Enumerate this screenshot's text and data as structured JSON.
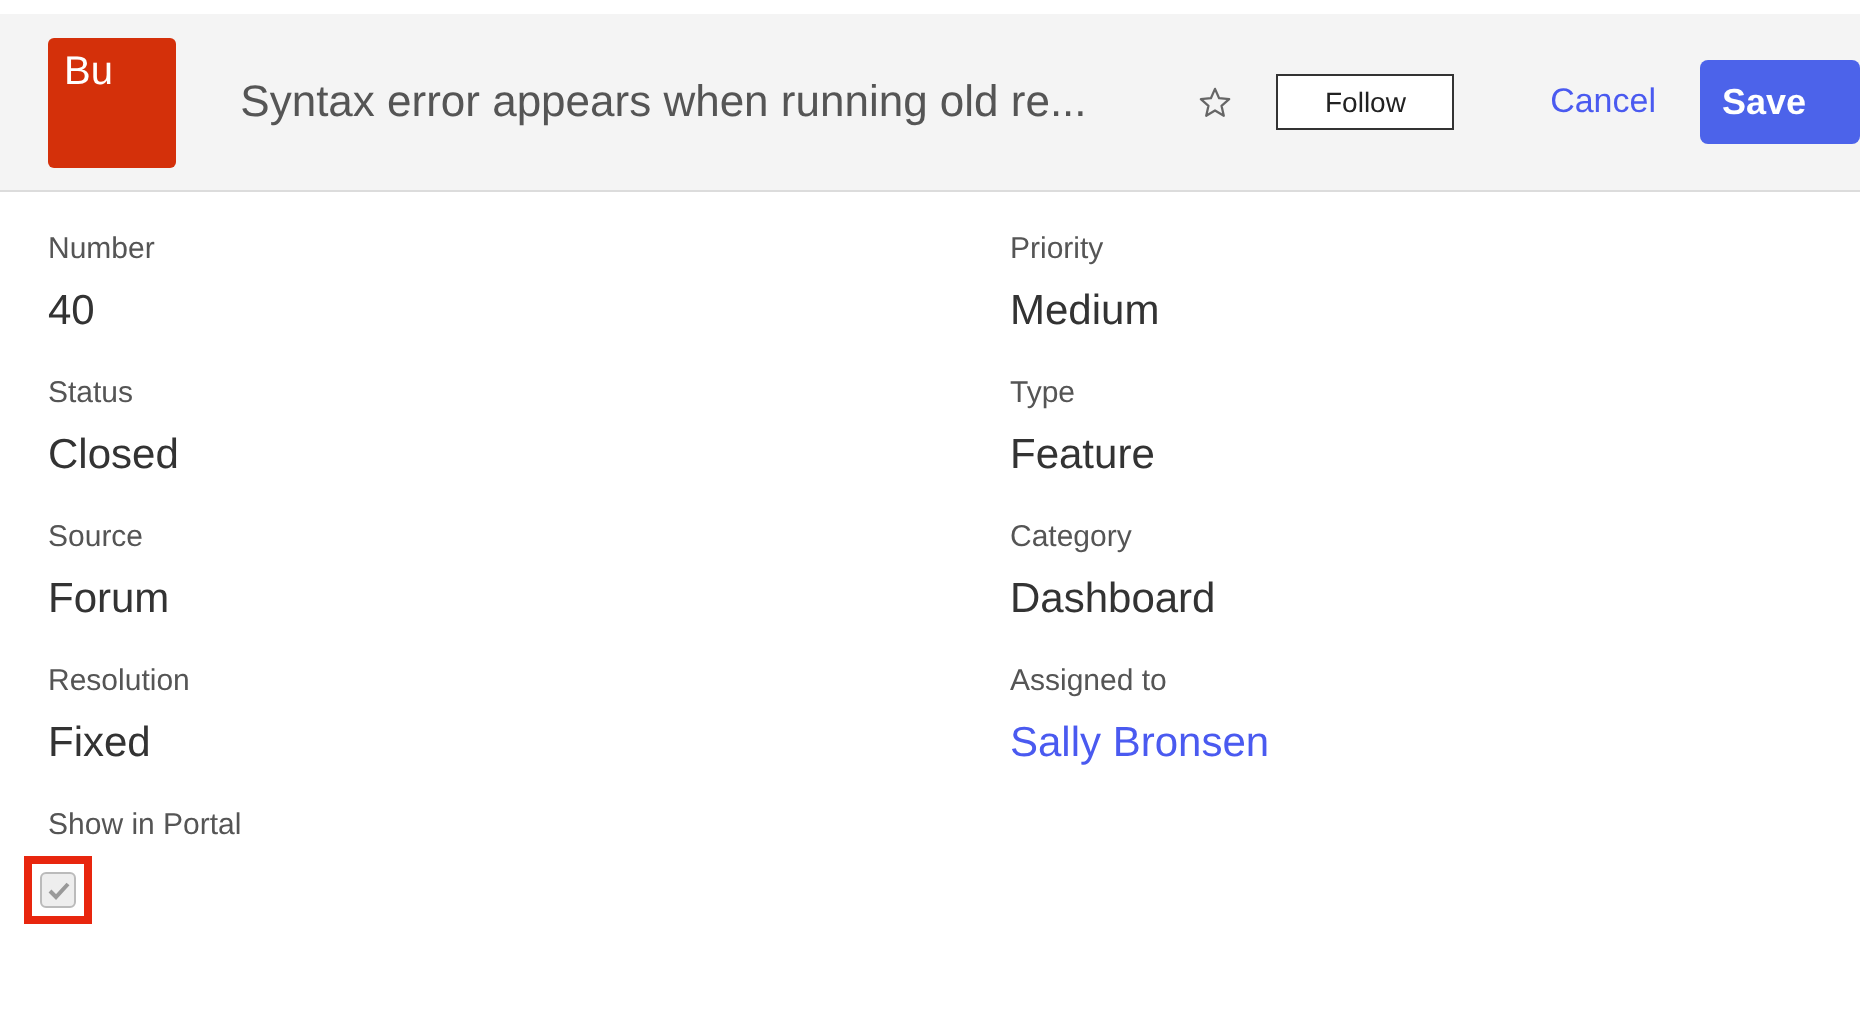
{
  "header": {
    "badge": "Bu",
    "title": "Syntax error appears when running old re...",
    "starred": false,
    "follow_label": "Follow",
    "cancel_label": "Cancel",
    "save_label": "Save"
  },
  "fields": [
    {
      "label": "Number",
      "value": "40",
      "kind": "text"
    },
    {
      "label": "Priority",
      "value": "Medium",
      "kind": "text"
    },
    {
      "label": "Status",
      "value": "Closed",
      "kind": "text"
    },
    {
      "label": "Type",
      "value": "Feature",
      "kind": "text"
    },
    {
      "label": "Source",
      "value": "Forum",
      "kind": "text"
    },
    {
      "label": "Category",
      "value": "Dashboard",
      "kind": "text"
    },
    {
      "label": "Resolution",
      "value": "Fixed",
      "kind": "text"
    },
    {
      "label": "Assigned to",
      "value": "Sally Bronsen",
      "kind": "link"
    },
    {
      "label": "Show in Portal",
      "kind": "checkbox",
      "checked": true,
      "disabled": true,
      "highlighted": true
    }
  ]
}
